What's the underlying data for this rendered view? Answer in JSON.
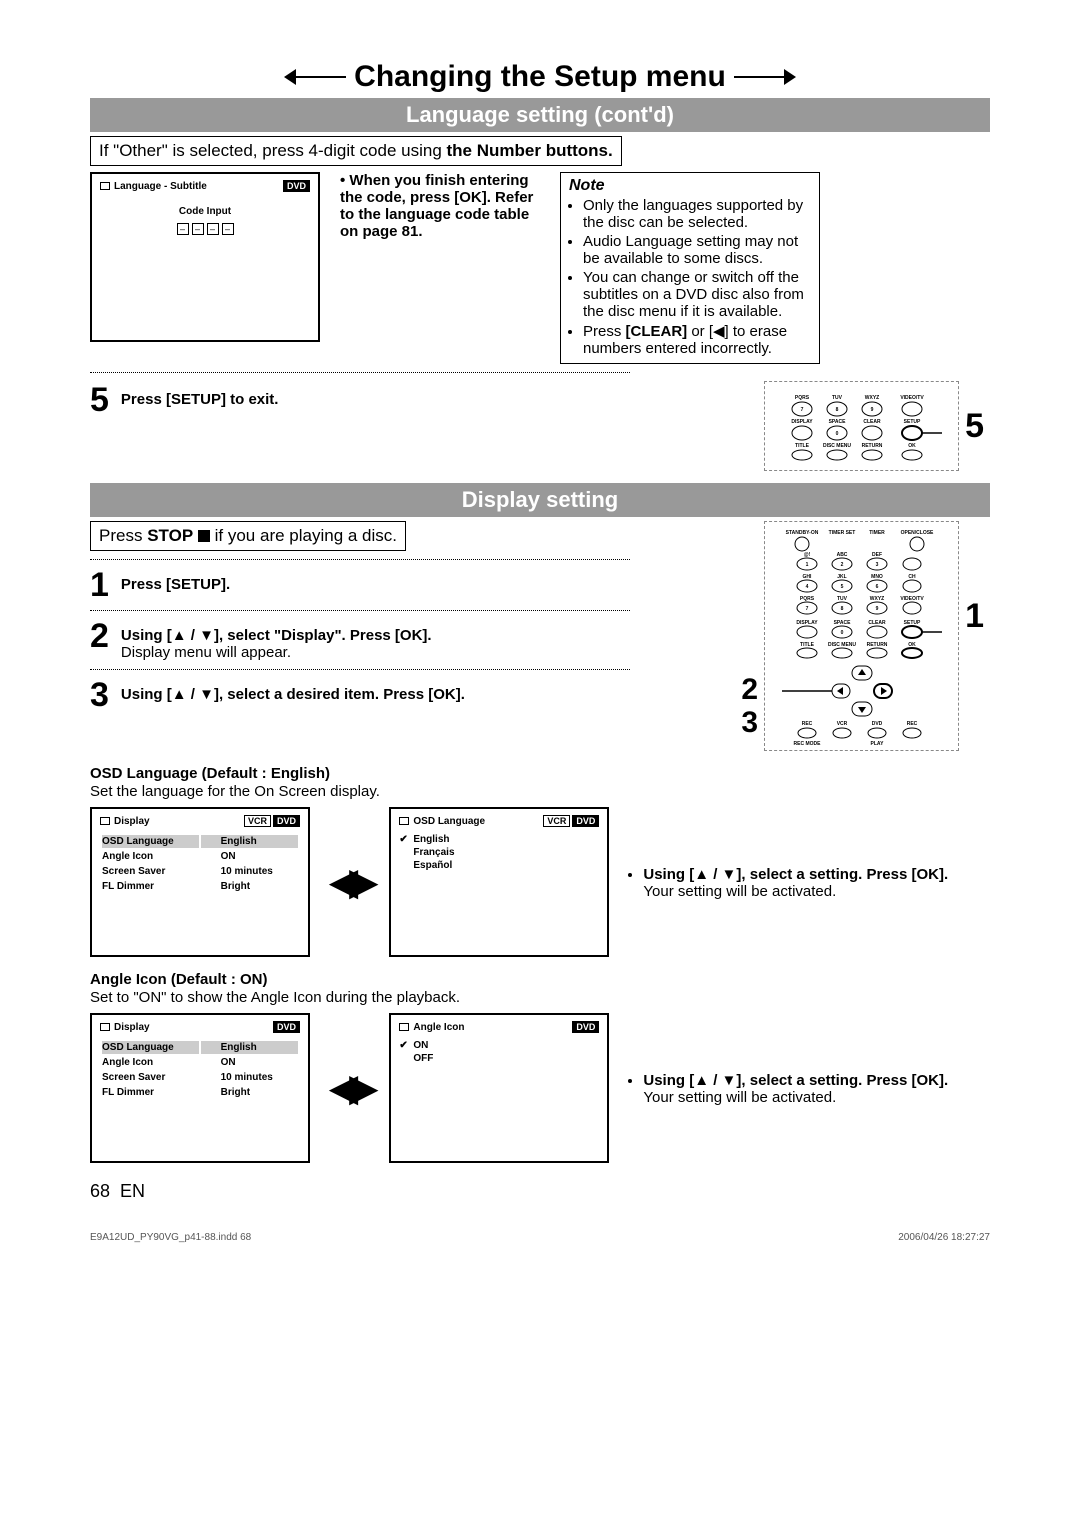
{
  "header": {
    "title": "Changing the Setup menu"
  },
  "lang_section": {
    "bar": "Language setting (cont'd)",
    "intro_pre": "If \"Other\" is selected, press 4-digit code using ",
    "intro_bold": "the Number buttons.",
    "osd": {
      "title": "Language - Subtitle",
      "badge": "DVD",
      "sub": "Code Input",
      "dash": "–"
    },
    "bullet": "When you finish entering the code, press [OK]. Refer to the language code table on page 81.",
    "note": {
      "title": "Note",
      "items": [
        "Only the languages supported by the disc can be selected.",
        "Audio Language setting may not be available to some discs.",
        "You can change or switch off the subtitles on a DVD disc also from the disc menu if it is available."
      ],
      "last_pre": "Press ",
      "last_b1": "[CLEAR]",
      "last_mid": " or [◀] to erase numbers entered incorrectly."
    },
    "step5_num": "5",
    "step5_text": "Press [SETUP] to exit.",
    "callout5": "5"
  },
  "disp_section": {
    "bar": "Display setting",
    "intro_pre": "Press ",
    "intro_b": "STOP",
    "intro_post": " if you are playing a disc.",
    "steps": {
      "s1": {
        "n": "1",
        "t": "Press [SETUP]."
      },
      "s2": {
        "n": "2",
        "t1": "Using [▲ / ▼], select \"Display\". Press [OK].",
        "t2": "Display menu will appear."
      },
      "s3": {
        "n": "3",
        "t": "Using [▲ / ▼], select a desired item. Press [OK]."
      }
    },
    "callouts": {
      "c1": "1",
      "c2": "2",
      "c3": "3"
    },
    "osd_lang": {
      "heading": "OSD Language (Default : English)",
      "desc": "Set the language for the On Screen display.",
      "left_title": "Display",
      "badges": [
        "VCR",
        "DVD"
      ],
      "rows": [
        [
          "OSD Language",
          "English"
        ],
        [
          "Angle Icon",
          "ON"
        ],
        [
          "Screen Saver",
          "10 minutes"
        ],
        [
          "FL Dimmer",
          "Bright"
        ]
      ],
      "right_title": "OSD Language",
      "right_items": [
        "English",
        "Français",
        "Español"
      ],
      "side_b": "Using [▲ / ▼], select a setting. Press [OK].",
      "side_t": "Your setting will be activated."
    },
    "angle": {
      "heading": "Angle Icon (Default : ON)",
      "desc": "Set to \"ON\" to show the Angle Icon during the playback.",
      "left_title": "Display",
      "left_badge": "DVD",
      "rows": [
        [
          "OSD Language",
          "English"
        ],
        [
          "Angle Icon",
          "ON"
        ],
        [
          "Screen Saver",
          "10 minutes"
        ],
        [
          "FL Dimmer",
          "Bright"
        ]
      ],
      "right_title": "Angle Icon",
      "right_badge": "DVD",
      "right_items": [
        "ON",
        "OFF"
      ],
      "side_b": "Using [▲ / ▼], select a setting. Press [OK].",
      "side_t": "Your setting will be activated."
    }
  },
  "remote_labels": {
    "row1": [
      "PQRS",
      "TUV",
      "WXYZ",
      "VIDEO/TV"
    ],
    "row1n": [
      "7",
      "8",
      "9",
      ""
    ],
    "row2": [
      "DISPLAY",
      "SPACE",
      "CLEAR",
      "SETUP"
    ],
    "row2n": [
      "",
      "0",
      "",
      ""
    ],
    "row3": [
      "TITLE",
      "DISC MENU",
      "RETURN",
      "OK"
    ],
    "top": [
      "STANDBY-ON",
      "TIMER SET",
      "TIMER",
      "OPEN/CLOSE"
    ],
    "num_labels": [
      "@!",
      "ABC",
      "DEF",
      "",
      "GHI",
      "JKL",
      "MNO",
      "CH",
      "PQRS",
      "TUV",
      "WXYZ",
      "VIDEO/TV"
    ],
    "nums": [
      "1",
      "2",
      "3",
      "",
      "4",
      "5",
      "6",
      "",
      "7",
      "8",
      "9",
      ""
    ],
    "bottom": [
      "REC",
      "VCR",
      "DVD",
      "REC",
      "REC MODE",
      "",
      "PLAY",
      ""
    ]
  },
  "page": {
    "num": "68",
    "lang": "EN"
  },
  "footer": {
    "left": "E9A12UD_PY90VG_p41-88.indd   68",
    "right": "2006/04/26   18:27:27"
  }
}
